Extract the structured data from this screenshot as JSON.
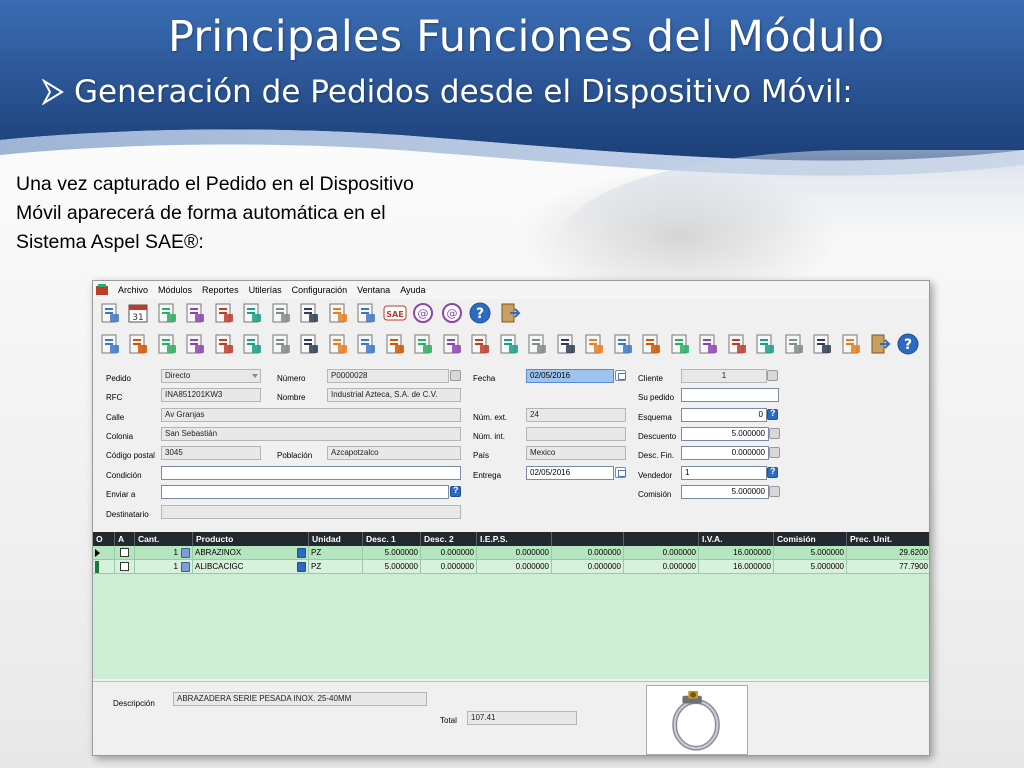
{
  "slide": {
    "title": "Principales Funciones del Módulo",
    "bullet": "Generación de Pedidos desde el Dispositivo Móvil:",
    "intro_lines": [
      "Una vez capturado el Pedido en el Dispositivo",
      "Móvil aparecerá de forma automática en el",
      "Sistema Aspel SAE®:"
    ],
    "colors": {
      "banner_blue": "#2b5aa0",
      "banner_dark": "#1c3f78"
    }
  },
  "app": {
    "menu": [
      "Archivo",
      "Módulos",
      "Reportes",
      "Utilerías",
      "Configuración",
      "Ventana",
      "Ayuda"
    ],
    "toolbar_icons_row1": [
      "document-icon",
      "calendar-icon",
      "calculator-icon",
      "lock-icon",
      "user-icon",
      "windows-icon",
      "edit-icon",
      "list-icon",
      "cart-icon",
      "chart-icon",
      "sae-logo-icon",
      "email-icon",
      "email-settings-icon",
      "help-icon",
      "exit-icon"
    ],
    "toolbar_icons_row2": [
      "save-icon",
      "report-icon",
      "copy-icon",
      "group-icon",
      "import-icon",
      "export-icon",
      "print-icon",
      "preview-icon",
      "user-search-icon",
      "catalog-icon",
      "find-icon",
      "folder-icon",
      "search-icon",
      "add-row-icon",
      "delete-row-icon",
      "layers-icon",
      "tree-icon",
      "monitor-icon",
      "connect-icon",
      "table-icon",
      "cloud-icon",
      "pie-icon",
      "refresh-icon",
      "grid-icon",
      "attach-icon",
      "printer-icon",
      "zoom-icon",
      "exit2-icon",
      "help2-icon"
    ],
    "form": {
      "pedido": {
        "label": "Pedido",
        "value": "Directo"
      },
      "numero": {
        "label": "Número",
        "value": "P0000028"
      },
      "fecha": {
        "label": "Fecha",
        "value": "02/05/2016"
      },
      "cliente": {
        "label": "Cliente",
        "value": "1"
      },
      "rfc": {
        "label": "RFC",
        "value": "INA851201KW3"
      },
      "nombre": {
        "label": "Nombre",
        "value": "Industrial Azteca, S.A. de C.V."
      },
      "su_pedido": {
        "label": "Su pedido",
        "value": ""
      },
      "calle": {
        "label": "Calle",
        "value": "Av Granjas"
      },
      "num_ext": {
        "label": "Núm. ext.",
        "value": "24"
      },
      "esquema": {
        "label": "Esquema",
        "value": "0"
      },
      "colonia": {
        "label": "Colonia",
        "value": "San Sebastián"
      },
      "num_int": {
        "label": "Núm. int.",
        "value": ""
      },
      "descuento": {
        "label": "Descuento",
        "value": "5.000000"
      },
      "codigo_postal": {
        "label": "Código postal",
        "value": "3045"
      },
      "poblacion": {
        "label": "Población",
        "value": "Azcapotzalco"
      },
      "pais": {
        "label": "País",
        "value": "Mexico"
      },
      "desc_fin": {
        "label": "Desc. Fin.",
        "value": "0.000000"
      },
      "condicion": {
        "label": "Condición",
        "value": ""
      },
      "entrega": {
        "label": "Entrega",
        "value": "02/05/2016"
      },
      "vendedor": {
        "label": "Vendedor",
        "value": "1"
      },
      "enviar_a": {
        "label": "Enviar a",
        "value": ""
      },
      "comision": {
        "label": "Comisión",
        "value": "5.000000"
      },
      "destinatario": {
        "label": "Destinatario",
        "value": ""
      }
    },
    "grid": {
      "headers": [
        "O",
        "A",
        "Cant.",
        "Producto",
        "Unidad",
        "Desc. 1",
        "Desc. 2",
        "I.E.P.S.",
        "",
        "",
        "I.V.A.",
        "Comisión",
        "Prec. Unit."
      ],
      "rows": [
        {
          "cant": "1",
          "producto": "ABRAZINOX",
          "unidad": "PZ",
          "desc1": "5.000000",
          "desc2": "0.000000",
          "ieps": "0.000000",
          "c8": "0.000000",
          "c9": "0.000000",
          "iva": "16.000000",
          "comision": "5.000000",
          "prec": "29.6200"
        },
        {
          "cant": "1",
          "producto": "ALIBCACIGC",
          "unidad": "PZ",
          "desc1": "5.000000",
          "desc2": "0.000000",
          "ieps": "0.000000",
          "c8": "0.000000",
          "c9": "0.000000",
          "iva": "16.000000",
          "comision": "5.000000",
          "prec": "77.7900"
        }
      ]
    },
    "bottom": {
      "descripcion_label": "Descripción",
      "descripcion_value": "ABRAZADERA SERIE PESADA INOX. 25-40MM",
      "total_label": "Total",
      "total_value": "107.41"
    }
  }
}
